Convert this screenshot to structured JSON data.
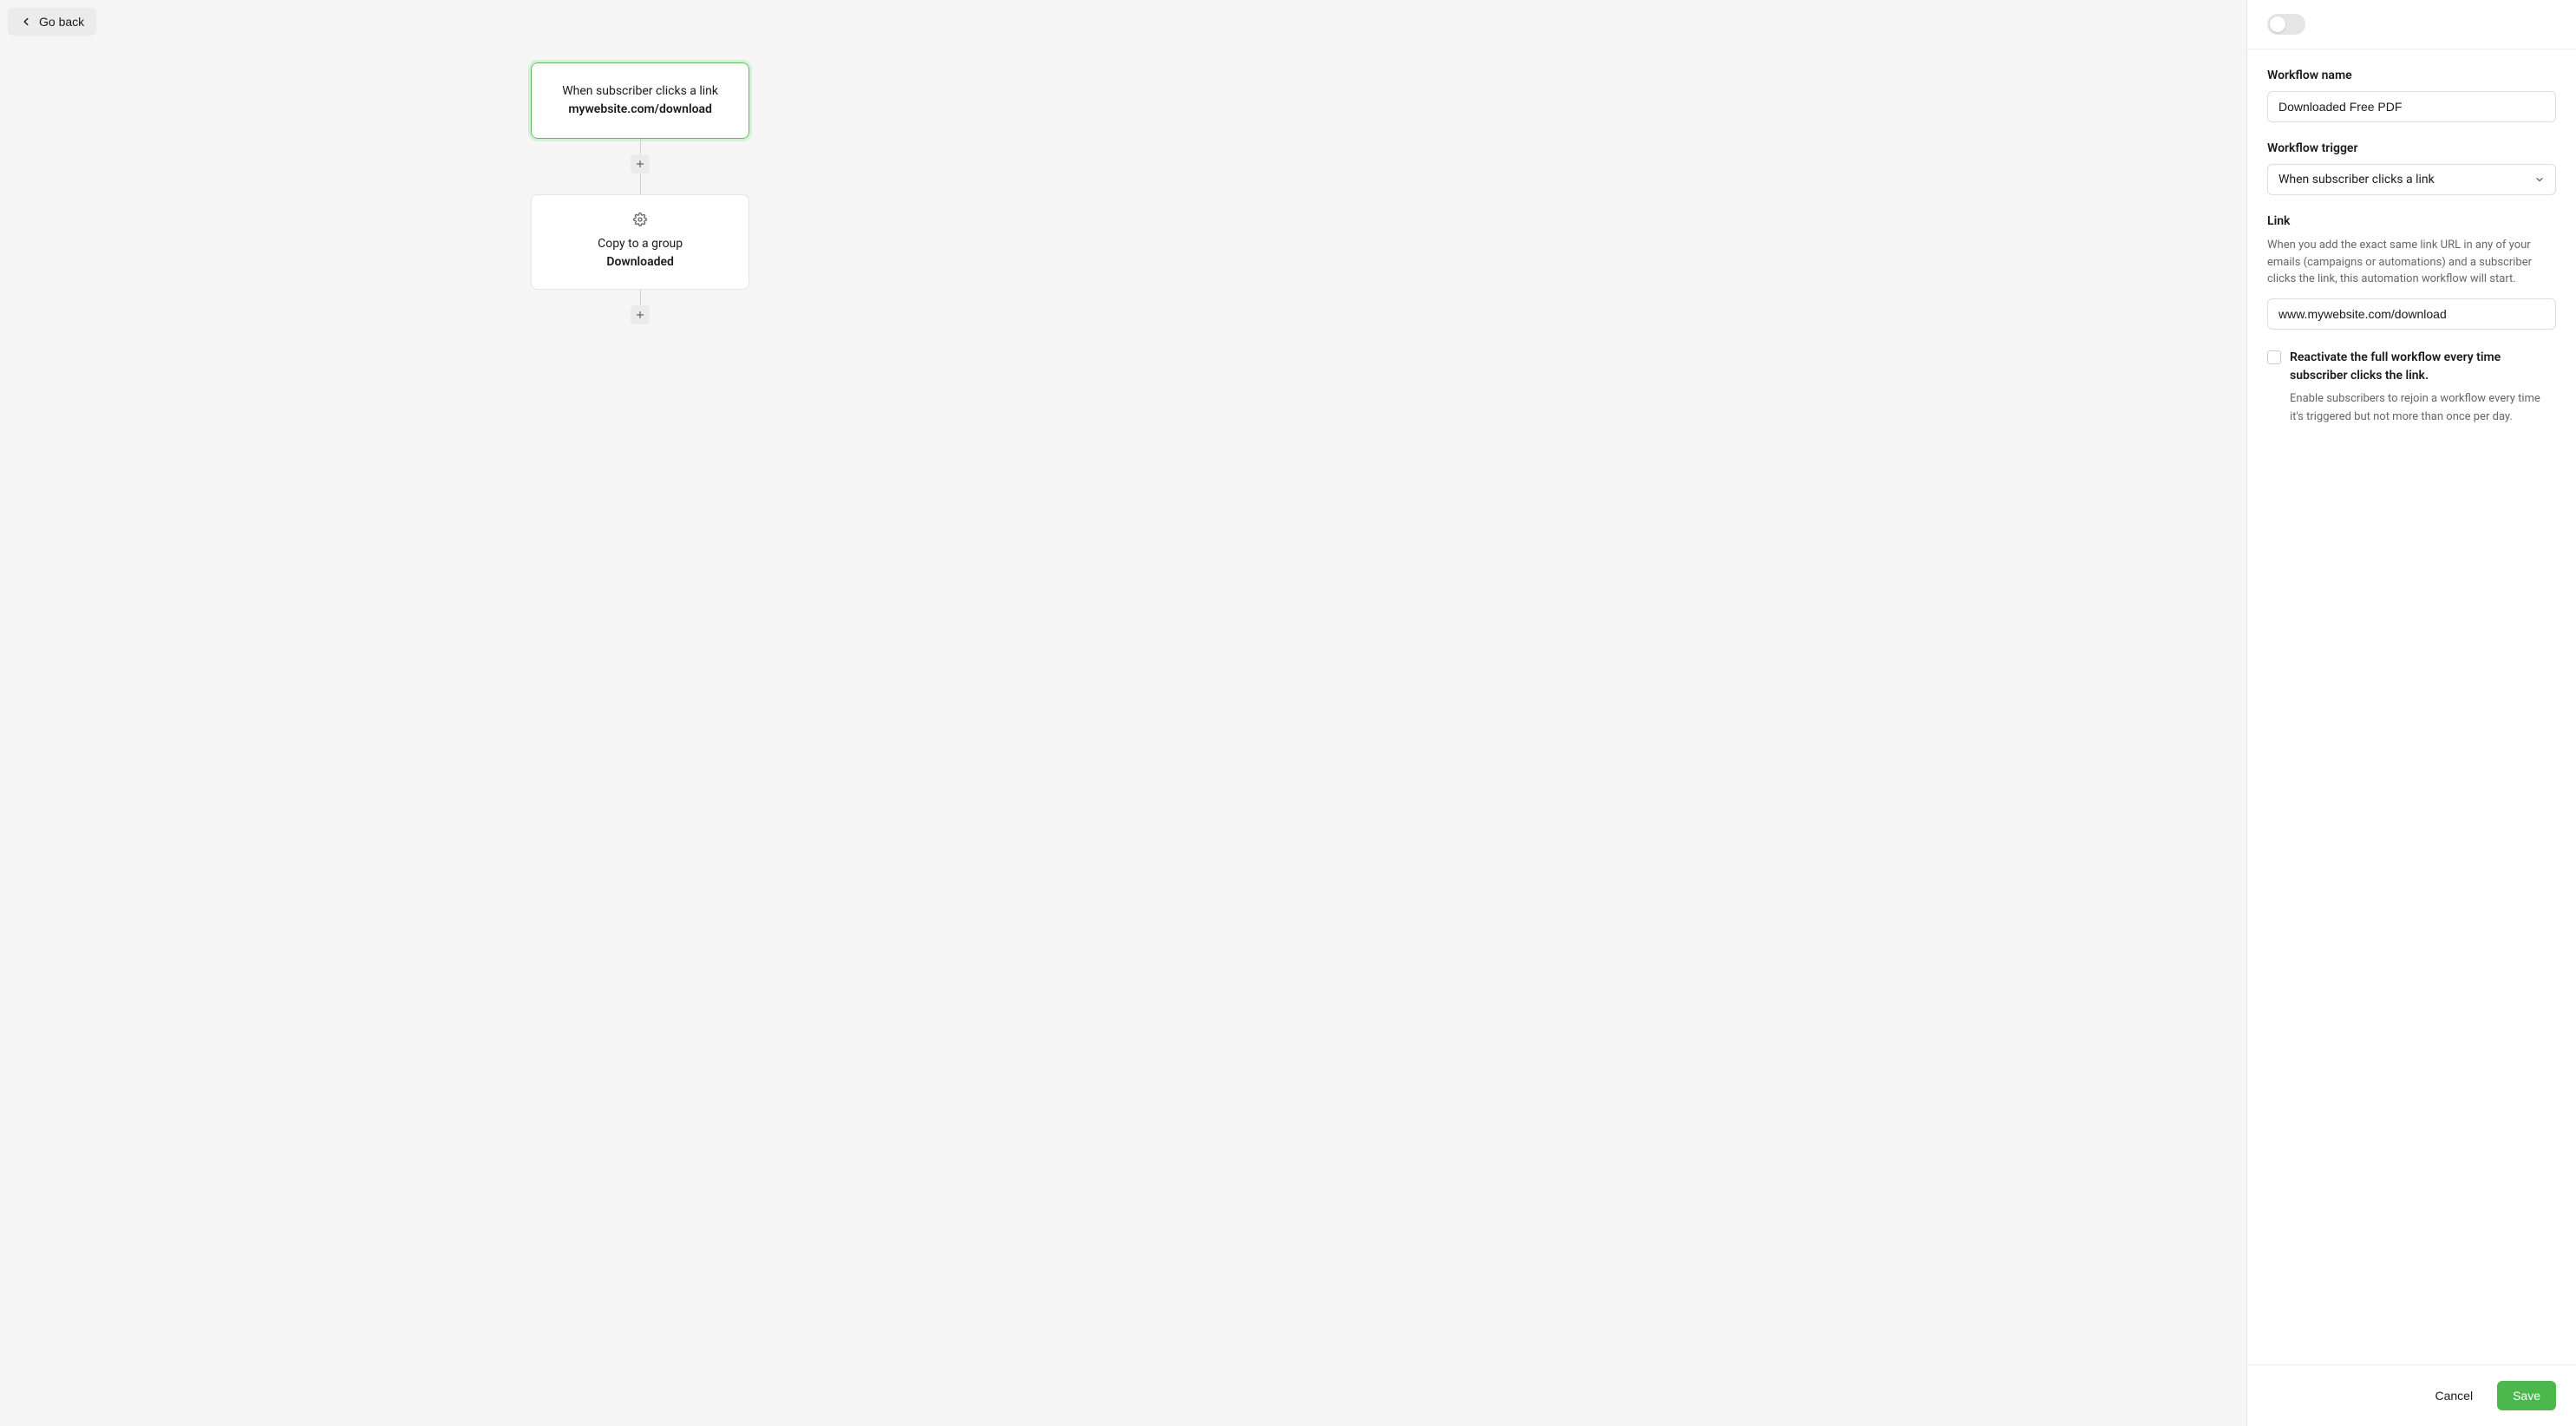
{
  "header": {
    "go_back": "Go back"
  },
  "canvas": {
    "trigger": {
      "title": "When subscriber clicks a link",
      "detail": "mywebsite.com/download"
    },
    "action": {
      "title": "Copy to a group",
      "detail": "Downloaded"
    }
  },
  "sidebar": {
    "name_label": "Workflow name",
    "name_value": "Downloaded Free PDF",
    "trigger_label": "Workflow trigger",
    "trigger_value": "When subscriber clicks a link",
    "link_label": "Link",
    "link_help": "When you add the exact same link URL in any of your emails (campaigns or automations) and a subscriber clicks the link, this automation workflow will start.",
    "link_value": "www.mywebsite.com/download",
    "reactivate_title": "Reactivate the full workflow every time subscriber clicks the link.",
    "reactivate_desc": "Enable subscribers to rejoin a workflow every time it's triggered but not more than once per day."
  },
  "footer": {
    "cancel": "Cancel",
    "save": "Save"
  }
}
